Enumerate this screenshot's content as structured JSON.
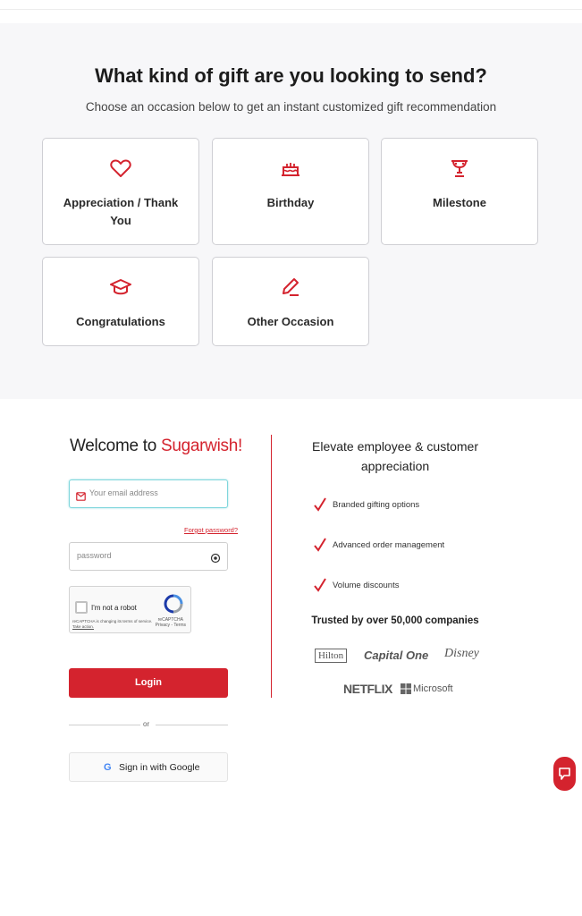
{
  "gift": {
    "title": "What kind of gift are you looking to send?",
    "subtitle": "Choose an occasion below to get an instant customized gift recommendation",
    "occasions": [
      {
        "label": "Appreciation / Thank You",
        "icon": "heart-icon"
      },
      {
        "label": "Birthday",
        "icon": "cake-icon"
      },
      {
        "label": "Milestone",
        "icon": "trophy-icon"
      },
      {
        "label": "Congratulations",
        "icon": "graduation-cap-icon"
      },
      {
        "label": "Other Occasion",
        "icon": "pencil-icon"
      }
    ]
  },
  "login": {
    "welcome": "Welcome to",
    "brand": "Sugarwish!",
    "email_placeholder": "Your email address",
    "forgot": "Forgot password?",
    "password_placeholder": "password",
    "captcha_label": "I'm not a robot",
    "captcha_brand": "reCAPTCHA",
    "captcha_links": "Privacy - Terms",
    "captcha_notice": "reCAPTCHA is changing its terms of service.",
    "captcha_action": "Take action.",
    "login_button": "Login",
    "or": "or",
    "google_button": "Sign in with Google"
  },
  "promo": {
    "heading": "Elevate employee & customer appreciation",
    "benefits": [
      "Branded gifting options",
      "Advanced order management",
      "Volume discounts"
    ],
    "trusted": "Trusted by over 50,000 companies",
    "logos": [
      "Hilton",
      "Capital One",
      "Disney",
      "NETFLIX",
      "Microsoft"
    ]
  },
  "colors": {
    "accent": "#d4232e",
    "section_bg": "#f7f7f9"
  }
}
